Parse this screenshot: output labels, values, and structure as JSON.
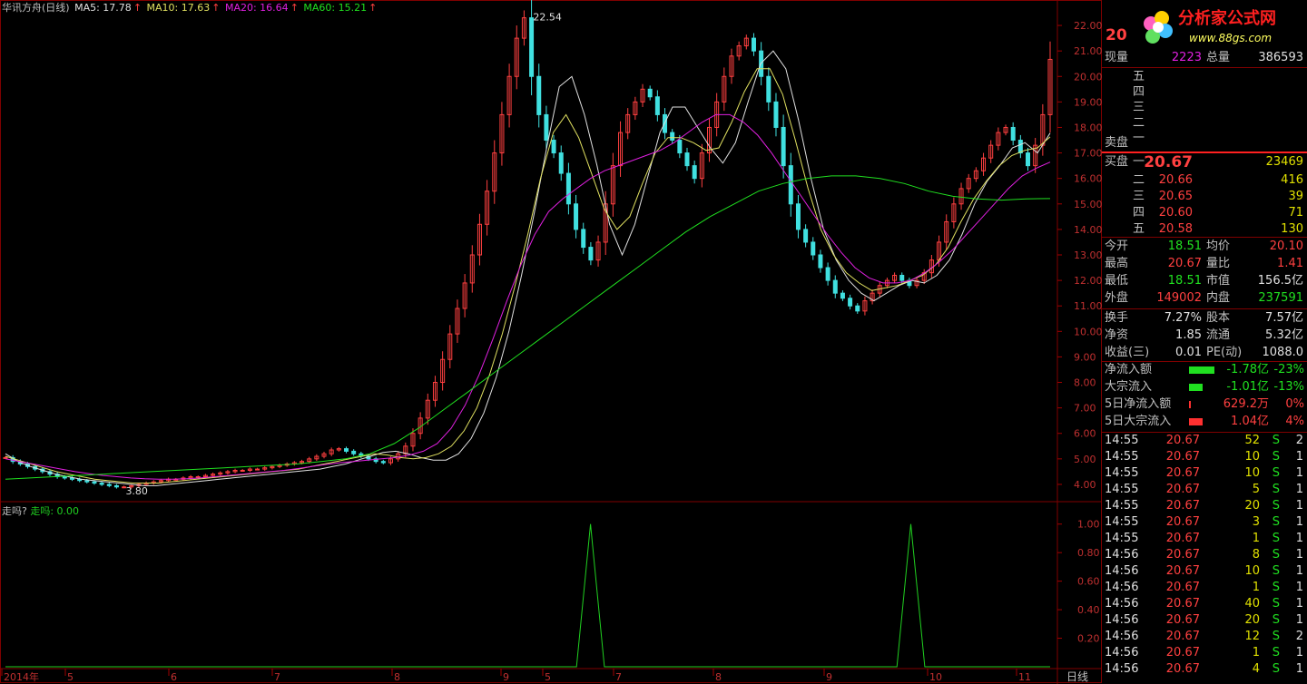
{
  "header": {
    "title": "华讯方舟(日线)",
    "ma5": "MA5: 17.78",
    "ma10": "MA10: 17.63",
    "ma20": "MA20: 16.64",
    "ma60": "MA60: 15.21",
    "arrow": "↑",
    "colors": {
      "title": "#c0c0c0",
      "ma5": "#e0e0e0",
      "ma10": "#e0e060",
      "ma20": "#e020e0",
      "ma60": "#20e020"
    }
  },
  "indicator": {
    "label": "走吗?",
    "series_label": "走吗: 0.00"
  },
  "logo": {
    "name": "分析家公式网",
    "url": "www.88gs.com"
  },
  "quote": {
    "price_big": "20",
    "xianliang_label": "现量",
    "xianliang": "2223",
    "zongliang_label": "总量",
    "zongliang": "386593",
    "sell_levels": [
      "五",
      "四",
      "三",
      "二",
      "一"
    ],
    "sell_label": "卖盘",
    "buy_label": "买盘",
    "buy": [
      {
        "lvl": "一",
        "price": "20.67",
        "vol": "23469"
      },
      {
        "lvl": "二",
        "price": "20.66",
        "vol": "416"
      },
      {
        "lvl": "三",
        "price": "20.65",
        "vol": "39"
      },
      {
        "lvl": "四",
        "price": "20.60",
        "vol": "71"
      },
      {
        "lvl": "五",
        "price": "20.58",
        "vol": "130"
      }
    ],
    "stats": [
      [
        {
          "l": "今开",
          "v": "18.51",
          "c": "green"
        },
        {
          "l": "均价",
          "v": "20.10",
          "c": "red"
        }
      ],
      [
        {
          "l": "最高",
          "v": "20.67",
          "c": "red"
        },
        {
          "l": "量比",
          "v": "1.41",
          "c": "red"
        }
      ],
      [
        {
          "l": "最低",
          "v": "18.51",
          "c": "green"
        },
        {
          "l": "市值",
          "v": "156.5亿",
          "c": "white"
        }
      ],
      [
        {
          "l": "外盘",
          "v": "149002",
          "c": "red"
        },
        {
          "l": "内盘",
          "v": "237591",
          "c": "green"
        }
      ]
    ],
    "fund": [
      [
        {
          "l": "换手",
          "v": "7.27%",
          "c": "white"
        },
        {
          "l": "股本",
          "v": "7.57亿",
          "c": "white"
        }
      ],
      [
        {
          "l": "净资",
          "v": "1.85",
          "c": "white"
        },
        {
          "l": "流通",
          "v": "5.32亿",
          "c": "white"
        }
      ],
      [
        {
          "l": "收益(三)",
          "v": "0.01",
          "c": "white"
        },
        {
          "l": "PE(动)",
          "v": "1088.0",
          "c": "white"
        }
      ]
    ],
    "flow": [
      {
        "l": "净流入额",
        "v": "-1.78亿",
        "p": "-23%",
        "c": "green",
        "bar": 0.55
      },
      {
        "l": "大宗流入",
        "v": "-1.01亿",
        "p": "-13%",
        "c": "green",
        "bar": 0.3
      },
      {
        "l": "5日净流入额",
        "v": "629.2万",
        "p": "0%",
        "c": "red",
        "bar": 0.02
      },
      {
        "l": "5日大宗流入",
        "v": "1.04亿",
        "p": "4%",
        "c": "red",
        "bar": 0.3
      }
    ],
    "ticks": [
      [
        "14:55",
        "20.67",
        "52",
        "S",
        "2"
      ],
      [
        "14:55",
        "20.67",
        "10",
        "S",
        "1"
      ],
      [
        "14:55",
        "20.67",
        "10",
        "S",
        "1"
      ],
      [
        "14:55",
        "20.67",
        "5",
        "S",
        "1"
      ],
      [
        "14:55",
        "20.67",
        "20",
        "S",
        "1"
      ],
      [
        "14:55",
        "20.67",
        "3",
        "S",
        "1"
      ],
      [
        "14:55",
        "20.67",
        "1",
        "S",
        "1"
      ],
      [
        "14:56",
        "20.67",
        "8",
        "S",
        "1"
      ],
      [
        "14:56",
        "20.67",
        "10",
        "S",
        "1"
      ],
      [
        "14:56",
        "20.67",
        "1",
        "S",
        "1"
      ],
      [
        "14:56",
        "20.67",
        "40",
        "S",
        "1"
      ],
      [
        "14:56",
        "20.67",
        "20",
        "S",
        "1"
      ],
      [
        "14:56",
        "20.67",
        "12",
        "S",
        "2"
      ],
      [
        "14:56",
        "20.67",
        "1",
        "S",
        "1"
      ],
      [
        "14:56",
        "20.67",
        "4",
        "S",
        "1"
      ]
    ]
  },
  "chart_data": [
    {
      "type": "candlestick",
      "ylim": [
        3.5,
        22.5
      ],
      "y_ticks": [
        "22.00",
        "21.00",
        "20.00",
        "19.00",
        "18.00",
        "17.00",
        "16.00",
        "15.00",
        "14.00",
        "13.00",
        "12.00",
        "11.00",
        "10.00",
        "9.00",
        "8.00",
        "7.00",
        "6.00",
        "5.00",
        "4.00"
      ],
      "x_ticks": [
        "2014年",
        "5",
        "6",
        "7",
        "8",
        "9",
        "5",
        "7",
        "8",
        "9",
        "10",
        "11"
      ],
      "period_label": "日线",
      "annotations": [
        {
          "text": "22.54"
        },
        {
          "text": "3.80"
        }
      ],
      "close_series": [
        5.05,
        4.9,
        4.8,
        4.7,
        4.6,
        4.5,
        4.4,
        4.3,
        4.25,
        4.2,
        4.15,
        4.1,
        4.05,
        4.0,
        3.95,
        3.9,
        3.9,
        3.95,
        4.0,
        4.05,
        4.1,
        4.15,
        4.2,
        4.2,
        4.25,
        4.3,
        4.3,
        4.35,
        4.4,
        4.45,
        4.5,
        4.55,
        4.55,
        4.6,
        4.6,
        4.65,
        4.7,
        4.75,
        4.8,
        4.85,
        4.9,
        5.0,
        5.1,
        5.2,
        5.35,
        5.4,
        5.3,
        5.2,
        5.1,
        5.0,
        4.9,
        4.85,
        5.0,
        5.2,
        5.5,
        6.0,
        6.6,
        7.3,
        8.0,
        8.9,
        9.9,
        10.9,
        11.9,
        13.0,
        14.2,
        15.5,
        17.0,
        18.5,
        20.0,
        21.5,
        22.3,
        20.0,
        18.5,
        17.5,
        17.0,
        16.2,
        15.0,
        14.0,
        13.3,
        12.8,
        13.5,
        15.0,
        16.5,
        17.8,
        18.5,
        19.0,
        19.5,
        19.2,
        18.5,
        17.8,
        17.5,
        17.0,
        16.5,
        16.0,
        17.0,
        18.0,
        19.0,
        20.0,
        20.8,
        21.2,
        21.5,
        21.0,
        20.0,
        19.0,
        18.0,
        16.5,
        15.0,
        14.0,
        13.5,
        13.0,
        12.5,
        12.0,
        11.5,
        11.3,
        11.0,
        10.8,
        11.2,
        11.5,
        11.8,
        12.0,
        12.2,
        12.0,
        11.8,
        12.0,
        12.3,
        12.8,
        13.5,
        14.3,
        15.0,
        15.6,
        16.0,
        16.3,
        16.8,
        17.3,
        17.8,
        18.0,
        17.5,
        17.0,
        16.5,
        17.3,
        18.5,
        20.67
      ],
      "ma_series": [
        {
          "name": "MA5",
          "color": "#e0e0e0",
          "values": [
            5.2,
            4.9,
            4.7,
            4.55,
            4.4,
            4.3,
            4.2,
            4.15,
            4.1,
            4.05,
            4.0,
            3.95,
            3.95,
            4.0,
            4.05,
            4.1,
            4.15,
            4.2,
            4.25,
            4.3,
            4.35,
            4.4,
            4.45,
            4.5,
            4.55,
            4.6,
            4.7,
            4.8,
            4.95,
            5.1,
            5.25,
            5.3,
            5.2,
            5.05,
            4.95,
            4.95,
            5.2,
            5.8,
            6.8,
            8.2,
            10.0,
            12.2,
            14.6,
            17.2,
            19.6,
            20.0,
            18.5,
            16.5,
            14.2,
            13.0,
            14.2,
            16.0,
            17.8,
            18.8,
            18.8,
            18.0,
            17.2,
            16.6,
            17.4,
            19.0,
            20.5,
            21.0,
            20.3,
            18.3,
            16.0,
            14.0,
            12.8,
            12.0,
            11.5,
            11.2,
            11.5,
            11.8,
            12.0,
            11.9,
            12.2,
            12.8,
            13.8,
            15.0,
            15.9,
            16.5,
            17.2,
            17.4,
            17.0,
            17.78
          ]
        },
        {
          "name": "MA10",
          "color": "#e0e060",
          "values": [
            5.1,
            4.95,
            4.8,
            4.65,
            4.5,
            4.4,
            4.3,
            4.2,
            4.15,
            4.1,
            4.05,
            4.05,
            4.05,
            4.1,
            4.15,
            4.2,
            4.25,
            4.3,
            4.35,
            4.4,
            4.45,
            4.5,
            4.55,
            4.6,
            4.7,
            4.8,
            4.9,
            5.0,
            5.1,
            5.2,
            5.15,
            5.05,
            5.0,
            5.05,
            5.2,
            5.5,
            6.1,
            7.0,
            8.3,
            9.9,
            11.8,
            13.8,
            16.0,
            17.8,
            18.5,
            17.6,
            16.2,
            14.8,
            14.0,
            14.5,
            15.8,
            17.0,
            17.6,
            17.6,
            17.4,
            17.1,
            17.2,
            18.2,
            19.4,
            20.3,
            20.3,
            19.3,
            17.5,
            15.6,
            14.0,
            13.0,
            12.3,
            11.9,
            11.6,
            11.7,
            11.8,
            12.0,
            12.2,
            12.6,
            13.3,
            14.3,
            15.2,
            15.9,
            16.5,
            16.9,
            17.1,
            17.2,
            17.63
          ]
        },
        {
          "name": "MA20",
          "color": "#e020e0",
          "values": [
            5.0,
            4.9,
            4.8,
            4.7,
            4.6,
            4.5,
            4.42,
            4.35,
            4.3,
            4.25,
            4.22,
            4.2,
            4.2,
            4.22,
            4.25,
            4.3,
            4.35,
            4.4,
            4.45,
            4.5,
            4.55,
            4.62,
            4.7,
            4.78,
            4.85,
            4.9,
            4.95,
            5.0,
            5.05,
            5.15,
            5.3,
            5.6,
            6.2,
            7.1,
            8.3,
            9.7,
            11.2,
            12.6,
            13.8,
            14.7,
            15.2,
            15.6,
            16.0,
            16.3,
            16.5,
            16.7,
            16.9,
            17.1,
            17.4,
            17.8,
            18.2,
            18.5,
            18.5,
            18.2,
            17.7,
            17.0,
            16.2,
            15.4,
            14.6,
            13.8,
            13.1,
            12.5,
            12.1,
            11.9,
            11.9,
            12.0,
            12.3,
            12.7,
            13.2,
            13.8,
            14.4,
            15.0,
            15.6,
            16.1,
            16.4,
            16.64
          ]
        },
        {
          "name": "MA60",
          "color": "#20e020",
          "values": [
            4.2,
            4.25,
            4.3,
            4.35,
            4.4,
            4.45,
            4.5,
            4.55,
            4.6,
            4.65,
            4.7,
            4.75,
            4.8,
            4.9,
            5.0,
            5.2,
            5.6,
            6.2,
            6.9,
            7.6,
            8.3,
            9.0,
            9.7,
            10.4,
            11.1,
            11.8,
            12.5,
            13.2,
            13.9,
            14.5,
            15.0,
            15.5,
            15.8,
            16.0,
            16.1,
            16.1,
            16.0,
            15.8,
            15.5,
            15.3,
            15.2,
            15.15,
            15.2,
            15.21
          ]
        }
      ]
    },
    {
      "type": "line",
      "series": [
        {
          "name": "走吗",
          "color": "#20d020",
          "values": [
            0,
            0,
            0,
            0,
            0,
            0,
            0,
            0,
            0,
            0,
            0,
            0,
            0,
            0,
            0,
            0,
            0,
            0,
            0,
            0,
            0,
            0,
            0,
            0,
            0,
            0,
            0,
            0,
            0,
            0,
            0,
            0,
            0,
            0,
            0,
            0,
            0,
            0,
            0,
            0,
            0,
            0,
            1,
            0,
            0,
            0,
            0,
            0,
            0,
            0,
            0,
            0,
            0,
            0,
            0,
            0,
            0,
            0,
            0,
            0,
            0,
            0,
            0,
            0,
            0,
            1,
            0,
            0,
            0,
            0,
            0,
            0,
            0,
            0,
            0,
            0
          ]
        }
      ],
      "ylim": [
        0,
        1.1
      ],
      "y_ticks": [
        "1.00",
        "0.80",
        "0.60",
        "0.40",
        "0.20"
      ]
    }
  ]
}
